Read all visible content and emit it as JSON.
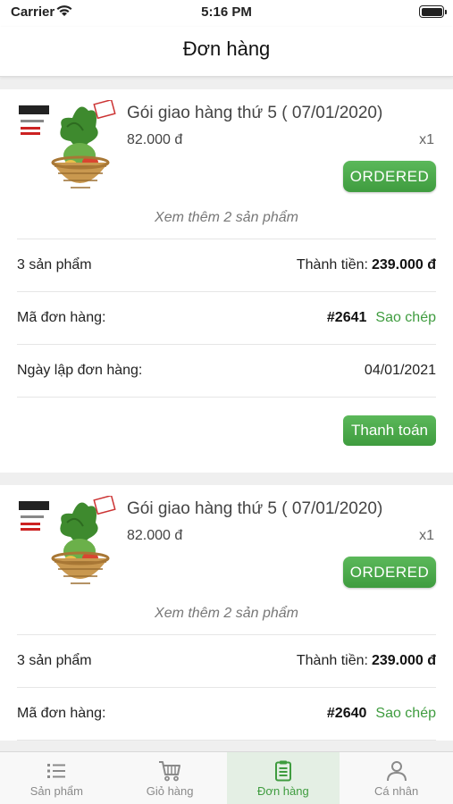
{
  "status_bar": {
    "carrier": "Carrier",
    "time": "5:16 PM"
  },
  "nav": {
    "title": "Đơn hàng"
  },
  "orders": [
    {
      "product_name": "Gói giao hàng thứ 5 ( 07/01/2020)",
      "product_price": "82.000 đ",
      "quantity": "x1",
      "status": "ORDERED",
      "see_more": "Xem thêm 2 sản phẩm",
      "item_count": "3 sản phẩm",
      "total_label": "Thành tiền:",
      "total_value": "239.000 đ",
      "order_id_label": "Mã đơn hàng:",
      "order_id": "#2641",
      "copy_label": "Sao chép",
      "date_label": "Ngày lập đơn hàng:",
      "date_value": "04/01/2021",
      "pay_label": "Thanh toán"
    },
    {
      "product_name": "Gói giao hàng thứ 5 ( 07/01/2020)",
      "product_price": "82.000 đ",
      "quantity": "x1",
      "status": "ORDERED",
      "see_more": "Xem thêm 2 sản phẩm",
      "item_count": "3 sản phẩm",
      "total_label": "Thành tiền:",
      "total_value": "239.000 đ",
      "order_id_label": "Mã đơn hàng:",
      "order_id": "#2640",
      "copy_label": "Sao chép"
    }
  ],
  "tabs": [
    {
      "label": "Sản phẩm",
      "icon": "list-icon",
      "active": false
    },
    {
      "label": "Giỏ hàng",
      "icon": "cart-icon",
      "active": false
    },
    {
      "label": "Đơn hàng",
      "icon": "clipboard-icon",
      "active": true
    },
    {
      "label": "Cá nhân",
      "icon": "person-icon",
      "active": false
    }
  ],
  "colors": {
    "accent_green": "#3f9c3f",
    "button_green": "#4caf50"
  }
}
